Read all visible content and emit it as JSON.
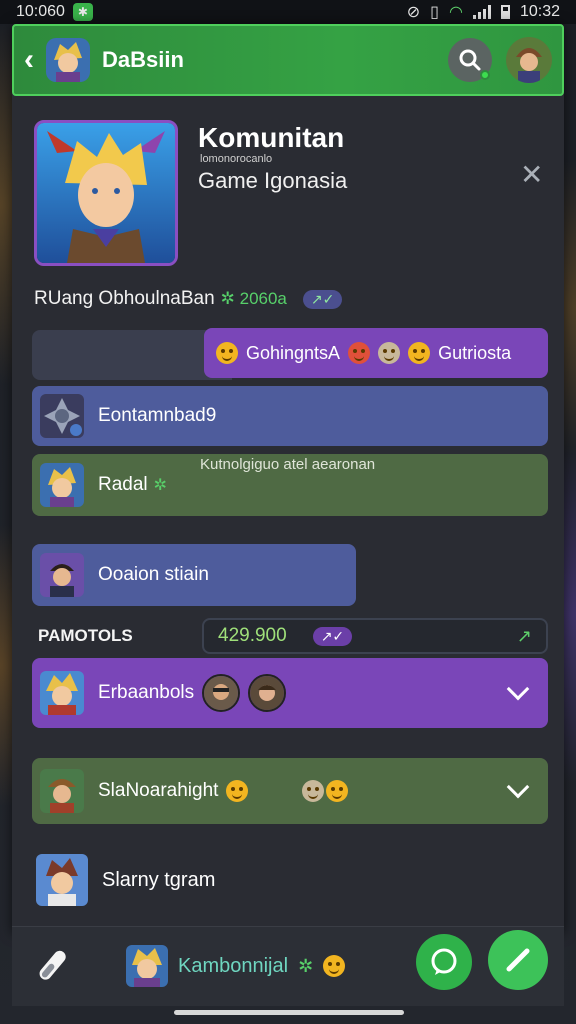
{
  "status_bar": {
    "time_left": "10:060",
    "time_right": "10:32"
  },
  "header": {
    "title": "DaBsiin"
  },
  "game": {
    "title": "Komunitan",
    "subtitle_small": "lomonorocanlo",
    "subtitle": "Game Igonasia"
  },
  "room": {
    "label": "RUang ObhoulnaBan",
    "count": "2060a"
  },
  "messages": {
    "purple_bubble": {
      "left_text": "GohingntsA",
      "right_text": "Gutriosta"
    },
    "blue_row": "Eontamnbad9",
    "green_row": "Radal",
    "green_row_floating": "Kutnolgiguo atel aearonan",
    "blue_small": "Ooaion stiain"
  },
  "section": {
    "label": "PAMOTOLS",
    "score": "429.900"
  },
  "members": [
    {
      "name": "Erbaanbols"
    },
    {
      "name": "SlaNoarahight"
    },
    {
      "name": "Slarny tgram"
    }
  ],
  "composer": {
    "text": "Kambonnijal"
  },
  "colors": {
    "header_green": "#35a244",
    "accent_purple": "#7a46b8",
    "accent_blue": "#4e5c9c",
    "accent_green_row": "#4f6a44"
  },
  "icons": [
    "back-arrow-icon",
    "search-icon",
    "close-icon",
    "chevron-down-icon",
    "attachment-icon",
    "chat-bubble-icon",
    "pencil-icon",
    "emoji-icon",
    "leaf-icon"
  ]
}
